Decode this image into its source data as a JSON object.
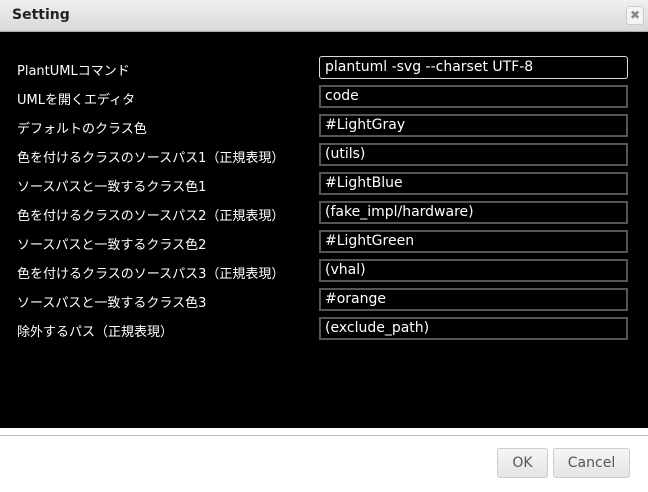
{
  "dialog": {
    "title": "Setting",
    "close_icon": "close-icon"
  },
  "fields": [
    {
      "label": "PlantUMLコマンド",
      "value": "plantuml -svg --charset UTF-8"
    },
    {
      "label": "UMLを開くエディタ",
      "value": "code"
    },
    {
      "label": "デフォルトのクラス色",
      "value": "#LightGray"
    },
    {
      "label": "色を付けるクラスのソースパス1（正規表現）",
      "value": "(utils)"
    },
    {
      "label": "ソースパスと一致するクラス色1",
      "value": "#LightBlue"
    },
    {
      "label": "色を付けるクラスのソースパス2（正規表現）",
      "value": "(fake_impl/hardware)"
    },
    {
      "label": "ソースパスと一致するクラス色2",
      "value": "#LightGreen"
    },
    {
      "label": "色を付けるクラスのソースパス3（正規表現）",
      "value": "(vhal)"
    },
    {
      "label": "ソースパスと一致するクラス色3",
      "value": "#orange"
    },
    {
      "label": "除外するパス（正規表現）",
      "value": "(exclude_path)"
    }
  ],
  "footer": {
    "ok_label": "OK",
    "cancel_label": "Cancel"
  }
}
